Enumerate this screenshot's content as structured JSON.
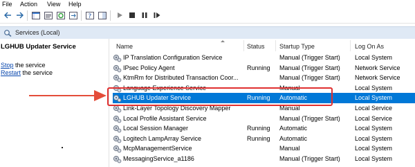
{
  "menu": [
    "File",
    "Action",
    "View",
    "Help"
  ],
  "toolbar_icons": [
    "back-arrow-icon",
    "forward-arrow-icon",
    "console-tree-icon",
    "properties-icon",
    "refresh-icon",
    "export-icon",
    "help-icon",
    "show-hide-icon",
    "play-icon",
    "stop-icon",
    "pause-icon",
    "resume-icon"
  ],
  "header": {
    "title": "Services (Local)"
  },
  "left_pane": {
    "service_title": "LGHUB Updater Service",
    "stop_link": "Stop",
    "stop_suffix": " the service",
    "restart_link": "Restart",
    "restart_suffix": " the service"
  },
  "table": {
    "columns": [
      "Name",
      "Status",
      "Startup Type",
      "Log On As"
    ],
    "rows": [
      {
        "name": "IP Translation Configuration Service",
        "status": "",
        "startup": "Manual (Trigger Start)",
        "logon": "Local System"
      },
      {
        "name": "IPsec Policy Agent",
        "status": "Running",
        "startup": "Manual (Trigger Start)",
        "logon": "Network Service"
      },
      {
        "name": "KtmRm for Distributed Transaction Coor...",
        "status": "",
        "startup": "Manual (Trigger Start)",
        "logon": "Network Service"
      },
      {
        "name": "Language Experience Service",
        "status": "",
        "startup": "Manual",
        "logon": "Local System"
      },
      {
        "name": "LGHUB Updater Service",
        "status": "Running",
        "startup": "Automatic",
        "logon": "Local System",
        "selected": true
      },
      {
        "name": "Link-Layer Topology Discovery Mapper",
        "status": "",
        "startup": "Manual",
        "logon": "Local Service"
      },
      {
        "name": "Local Profile Assistant Service",
        "status": "",
        "startup": "Manual (Trigger Start)",
        "logon": "Local Service"
      },
      {
        "name": "Local Session Manager",
        "status": "Running",
        "startup": "Automatic",
        "logon": "Local System"
      },
      {
        "name": "Logitech LampArray Service",
        "status": "Running",
        "startup": "Automatic",
        "logon": "Local System"
      },
      {
        "name": "McpManagementService",
        "status": "",
        "startup": "Manual",
        "logon": "Local System"
      },
      {
        "name": "MessagingService_a1186",
        "status": "",
        "startup": "Manual (Trigger Start)",
        "logon": "Local System"
      }
    ]
  },
  "colors": {
    "selection": "#0078d7",
    "annotation": "#e03030",
    "header_bg": "#dfe9f5"
  }
}
